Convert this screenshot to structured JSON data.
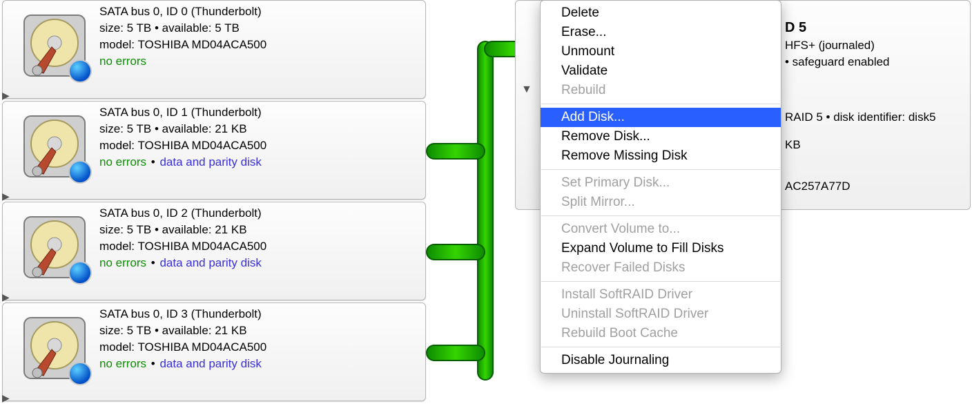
{
  "disks": [
    {
      "title": "SATA bus 0, ID 0 (Thunderbolt)",
      "size_line": "size: 5 TB • available: 5 TB",
      "model_line": "model: TOSHIBA MD04ACA500",
      "status_noerr": "no errors",
      "status_role": ""
    },
    {
      "title": "SATA bus 0, ID 1 (Thunderbolt)",
      "size_line": "size: 5 TB • available: 21 KB",
      "model_line": "model: TOSHIBA MD04ACA500",
      "status_noerr": "no errors",
      "status_role": "data and parity disk"
    },
    {
      "title": "SATA bus 0, ID 2 (Thunderbolt)",
      "size_line": "size: 5 TB • available: 21 KB",
      "model_line": "model: TOSHIBA MD04ACA500",
      "status_noerr": "no errors",
      "status_role": "data and parity disk"
    },
    {
      "title": "SATA bus 0, ID 3 (Thunderbolt)",
      "size_line": "size: 5 TB • available: 21 KB",
      "model_line": "model: TOSHIBA MD04ACA500",
      "status_noerr": "no errors",
      "status_role": "data and parity disk"
    }
  ],
  "volume": {
    "title_suffix": "D 5",
    "row1_suffix": "HFS+ (journaled)",
    "row2_suffix": " • safeguard enabled",
    "row3_suffix": "RAID 5 • disk identifier: disk5",
    "row4_suffix": " KB",
    "row5_suffix": "AC257A77D"
  },
  "menu": {
    "items": [
      {
        "label": "Delete",
        "enabled": true
      },
      {
        "label": "Erase...",
        "enabled": true
      },
      {
        "label": "Unmount",
        "enabled": true
      },
      {
        "label": "Validate",
        "enabled": true
      },
      {
        "label": "Rebuild",
        "enabled": false
      },
      {
        "sep": true
      },
      {
        "label": "Add Disk...",
        "enabled": true,
        "highlight": true
      },
      {
        "label": "Remove Disk...",
        "enabled": true
      },
      {
        "label": "Remove Missing Disk",
        "enabled": true
      },
      {
        "sep": true
      },
      {
        "label": "Set Primary Disk...",
        "enabled": false
      },
      {
        "label": "Split Mirror...",
        "enabled": false
      },
      {
        "sep": true
      },
      {
        "label": "Convert Volume to...",
        "enabled": false
      },
      {
        "label": "Expand Volume to Fill Disks",
        "enabled": true
      },
      {
        "label": "Recover Failed Disks",
        "enabled": false
      },
      {
        "sep": true
      },
      {
        "label": "Install SoftRAID Driver",
        "enabled": false
      },
      {
        "label": "Uninstall SoftRAID Driver",
        "enabled": false
      },
      {
        "label": "Rebuild Boot Cache",
        "enabled": false
      },
      {
        "sep": true
      },
      {
        "label": "Disable Journaling",
        "enabled": true
      }
    ]
  }
}
